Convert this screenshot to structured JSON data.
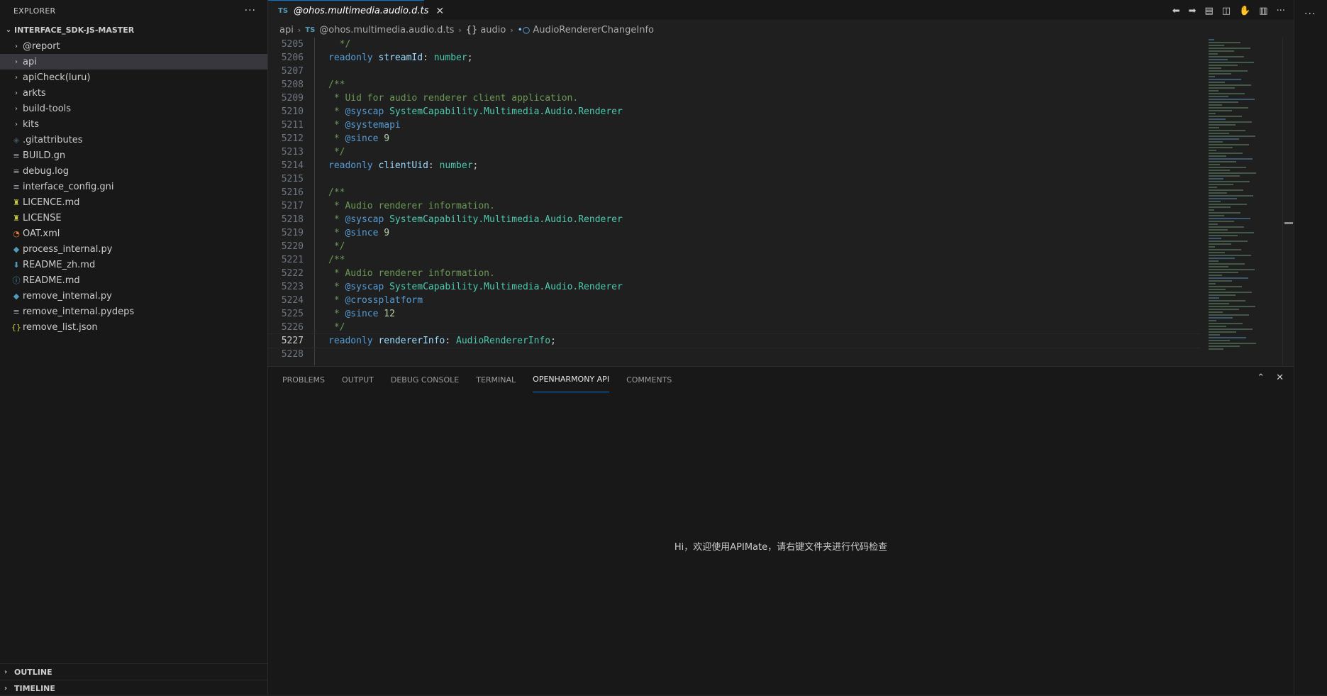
{
  "sidebar": {
    "header": "EXPLORER",
    "more": "···",
    "root_label": "INTERFACE_SDK-JS-MASTER",
    "items": [
      {
        "label": "@report",
        "icon": "chevron-right-icon",
        "kind": "folder"
      },
      {
        "label": "api",
        "icon": "chevron-right-icon",
        "kind": "folder",
        "selected": true
      },
      {
        "label": "apiCheck(luru)",
        "icon": "chevron-right-icon",
        "kind": "folder"
      },
      {
        "label": "arkts",
        "icon": "chevron-right-icon",
        "kind": "folder"
      },
      {
        "label": "build-tools",
        "icon": "chevron-right-icon",
        "kind": "folder"
      },
      {
        "label": "kits",
        "icon": "chevron-right-icon",
        "kind": "folder"
      },
      {
        "label": ".gitattributes",
        "icon": "git-icon",
        "kind": "file"
      },
      {
        "label": "BUILD.gn",
        "icon": "lines-icon",
        "kind": "file"
      },
      {
        "label": "debug.log",
        "icon": "lines-icon",
        "kind": "file"
      },
      {
        "label": "interface_config.gni",
        "icon": "lines-icon",
        "kind": "file"
      },
      {
        "label": "LICENCE.md",
        "icon": "license-icon",
        "kind": "file"
      },
      {
        "label": "LICENSE",
        "icon": "license-icon",
        "kind": "file"
      },
      {
        "label": "OAT.xml",
        "icon": "rss-icon",
        "kind": "file"
      },
      {
        "label": "process_internal.py",
        "icon": "python-icon",
        "kind": "file"
      },
      {
        "label": "README_zh.md",
        "icon": "download-icon",
        "kind": "file"
      },
      {
        "label": "README.md",
        "icon": "info-icon",
        "kind": "file"
      },
      {
        "label": "remove_internal.py",
        "icon": "python-icon",
        "kind": "file"
      },
      {
        "label": "remove_internal.pydeps",
        "icon": "lines-icon",
        "kind": "file"
      },
      {
        "label": "remove_list.json",
        "icon": "json-icon",
        "kind": "file"
      }
    ],
    "outline": "OUTLINE",
    "timeline": "TIMELINE"
  },
  "editor": {
    "tab": {
      "badge": "TS",
      "title": "@ohos.multimedia.audio.d.ts"
    },
    "breadcrumb": {
      "folder": "api",
      "badge": "TS",
      "file": "@ohos.multimedia.audio.d.ts",
      "namespace": "audio",
      "namespace_sym": "{}",
      "interface": "AudioRendererChangeInfo"
    },
    "current_line": "5227",
    "lines": [
      {
        "n": "5205",
        "t": "  */"
      },
      {
        "n": "5206",
        "t": "readonly streamId: number;"
      },
      {
        "n": "5207",
        "t": ""
      },
      {
        "n": "5208",
        "t": "/**"
      },
      {
        "n": "5209",
        "t": " * Uid for audio renderer client application."
      },
      {
        "n": "5210",
        "t": " * @syscap SystemCapability.Multimedia.Audio.Renderer"
      },
      {
        "n": "5211",
        "t": " * @systemapi"
      },
      {
        "n": "5212",
        "t": " * @since 9"
      },
      {
        "n": "5213",
        "t": " */"
      },
      {
        "n": "5214",
        "t": "readonly clientUid: number;"
      },
      {
        "n": "5215",
        "t": ""
      },
      {
        "n": "5216",
        "t": "/**"
      },
      {
        "n": "5217",
        "t": " * Audio renderer information."
      },
      {
        "n": "5218",
        "t": " * @syscap SystemCapability.Multimedia.Audio.Renderer"
      },
      {
        "n": "5219",
        "t": " * @since 9"
      },
      {
        "n": "5220",
        "t": " */"
      },
      {
        "n": "5221",
        "t": "/**"
      },
      {
        "n": "5222",
        "t": " * Audio renderer information."
      },
      {
        "n": "5223",
        "t": " * @syscap SystemCapability.Multimedia.Audio.Renderer"
      },
      {
        "n": "5224",
        "t": " * @crossplatform"
      },
      {
        "n": "5225",
        "t": " * @since 12"
      },
      {
        "n": "5226",
        "t": " */"
      },
      {
        "n": "5227",
        "t": "readonly rendererInfo: AudioRendererInfo;"
      },
      {
        "n": "5228",
        "t": ""
      }
    ]
  },
  "panel": {
    "tabs": [
      "PROBLEMS",
      "OUTPUT",
      "DEBUG CONSOLE",
      "TERMINAL",
      "OPENHARMONY API",
      "COMMENTS"
    ],
    "active_tab": "OPENHARMONY API",
    "welcome": "Hi，欢迎使用APIMate，请右键文件夹进行代码检查"
  },
  "colors": {
    "accent": "#0078d4",
    "comment": "#6a9955",
    "keyword": "#569cd6",
    "property": "#9cdcfe",
    "type": "#4ec9b0"
  }
}
